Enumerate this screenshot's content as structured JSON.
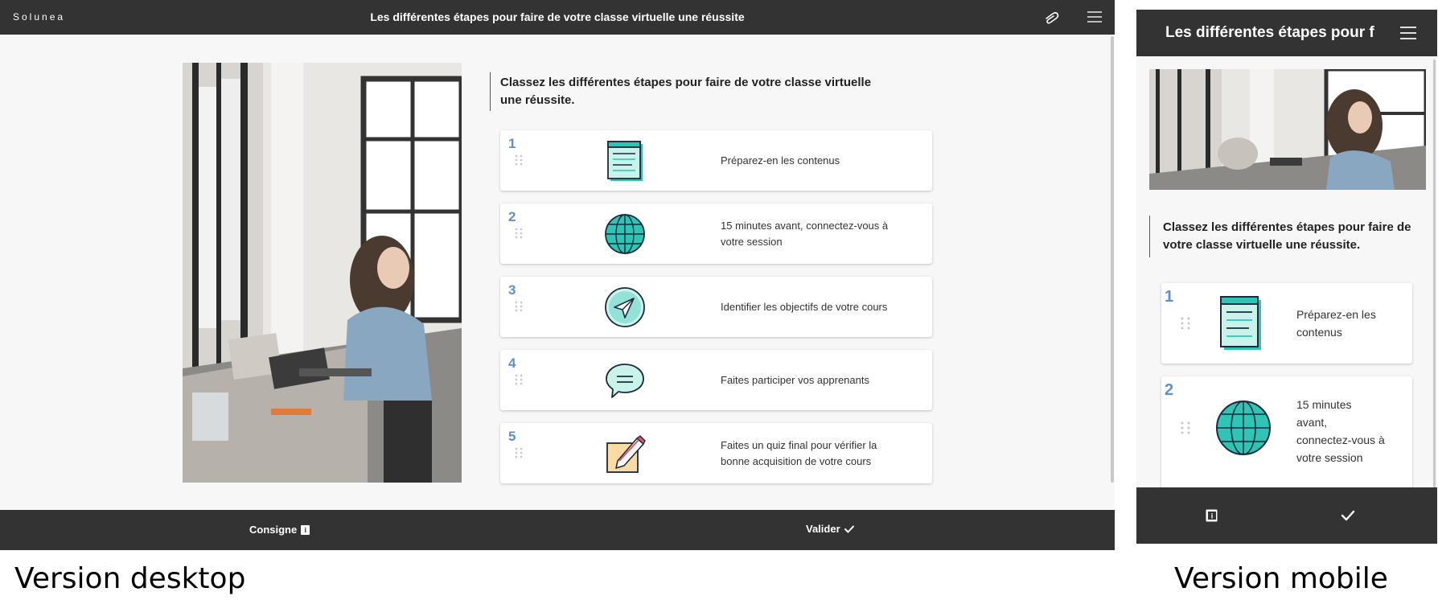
{
  "desktop": {
    "logo": "Solunea",
    "title": "Les différentes étapes pour faire de votre classe virtuelle une réussite",
    "instruction": "Classez les différentes étapes pour faire de votre classe virtuelle une réussite.",
    "items": [
      {
        "number": "1",
        "text": "Préparez-en les contenus",
        "icon": "notebook-icon"
      },
      {
        "number": "2",
        "text": "15 minutes avant, connectez-vous à votre session",
        "icon": "globe-icon"
      },
      {
        "number": "3",
        "text": "Identifier les objectifs de votre cours",
        "icon": "paper-plane-icon"
      },
      {
        "number": "4",
        "text": "Faites participer vos apprenants",
        "icon": "chat-bubble-icon"
      },
      {
        "number": "5",
        "text": "Faites un quiz final pour vérifier la bonne acquisition de votre cours",
        "icon": "pencil-note-icon"
      }
    ],
    "footer": {
      "consigne_label": "Consigne",
      "valider_label": "Valider"
    }
  },
  "mobile": {
    "title": "Les différentes étapes pour f",
    "instruction": "Classez les différentes étapes pour faire de votre classe virtuelle une réussite.",
    "items": [
      {
        "number": "1",
        "text": "Préparez-en les contenus",
        "icon": "notebook-icon"
      },
      {
        "number": "2",
        "text": "15 minutes avant, connectez-vous à votre session",
        "icon": "globe-icon"
      }
    ]
  },
  "captions": {
    "desktop": "Version desktop",
    "mobile": "Version mobile"
  },
  "colors": {
    "bar": "#333333",
    "background": "#f7f7f8",
    "number_accent": "#5b8fd6",
    "icon_teal": "#2ec4b6",
    "icon_light": "#c9f3ea"
  }
}
